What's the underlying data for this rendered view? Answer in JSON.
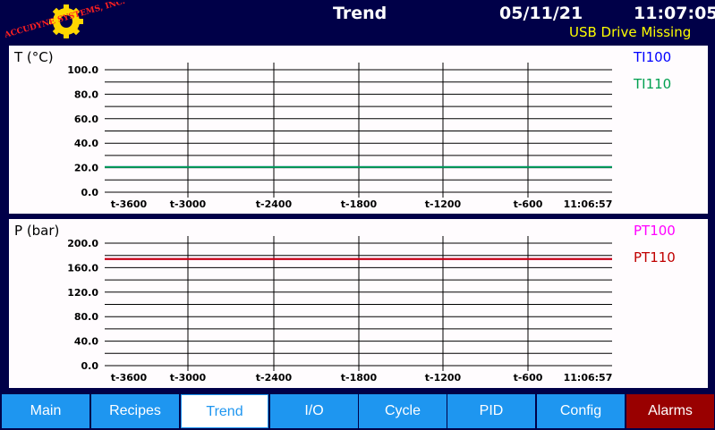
{
  "header": {
    "logo_text": "ACCUDYNE SYSTEMS, INC.",
    "title": "Trend",
    "date": "05/11/21",
    "time": "11:07:05",
    "status": "USB Drive Missing"
  },
  "colors": {
    "background": "#000048",
    "panel": "#fffcfe",
    "nav_button": "#1e96f0",
    "nav_active_bg": "#ffffff",
    "alarm_button": "#990000",
    "status_text": "#ffff00",
    "ti100": "#0000ff",
    "ti110": "#00a050",
    "pt100": "#ff00ff",
    "pt110": "#c00000"
  },
  "temp_chart": {
    "ylabel": "T (°C)",
    "ylim": [
      0,
      100
    ],
    "y_ticks": [
      "100.0",
      "80.0",
      "60.0",
      "40.0",
      "20.0",
      "0.0"
    ],
    "x_ticks": [
      "t-3600",
      "t-3000",
      "t-2400",
      "t-1800",
      "t-1200",
      "t-600",
      "11:06:57"
    ],
    "series": [
      {
        "name": "TI100",
        "color": "#0000ff",
        "values": [
          20.5,
          20.5
        ]
      },
      {
        "name": "TI110",
        "color": "#00a050",
        "values": [
          20.5,
          20.5
        ]
      }
    ]
  },
  "pres_chart": {
    "ylabel": "P (bar)",
    "ylim": [
      0,
      200
    ],
    "y_ticks": [
      "200.0",
      "160.0",
      "120.0",
      "80.0",
      "40.0",
      "0.0"
    ],
    "x_ticks": [
      "t-3600",
      "t-3000",
      "t-2400",
      "t-1800",
      "t-1200",
      "t-600",
      "11:06:57"
    ],
    "series": [
      {
        "name": "PT100",
        "color": "#ff00ff",
        "values": [
          174,
          174
        ]
      },
      {
        "name": "PT110",
        "color": "#c00000",
        "values": [
          174,
          174
        ]
      }
    ]
  },
  "chart_data": [
    {
      "type": "line",
      "ylabel": "T (°C)",
      "ylim": [
        0,
        100
      ],
      "x": [
        "t-3600",
        "11:06:57"
      ],
      "x_tick_labels": [
        "t-3600",
        "t-3000",
        "t-2400",
        "t-1800",
        "t-1200",
        "t-600",
        "11:06:57"
      ],
      "series": [
        {
          "name": "TI100",
          "values": [
            20.5,
            20.5
          ]
        },
        {
          "name": "TI110",
          "values": [
            20.5,
            20.5
          ]
        }
      ],
      "grid": true,
      "legend": "top-right"
    },
    {
      "type": "line",
      "ylabel": "P (bar)",
      "ylim": [
        0,
        200
      ],
      "x": [
        "t-3600",
        "11:06:57"
      ],
      "x_tick_labels": [
        "t-3600",
        "t-3000",
        "t-2400",
        "t-1800",
        "t-1200",
        "t-600",
        "11:06:57"
      ],
      "series": [
        {
          "name": "PT100",
          "values": [
            174,
            174
          ]
        },
        {
          "name": "PT110",
          "values": [
            174,
            174
          ]
        }
      ],
      "grid": true,
      "legend": "top-right"
    }
  ],
  "nav": {
    "items": [
      {
        "label": "Main",
        "name": "nav-main"
      },
      {
        "label": "Recipes",
        "name": "nav-recipes"
      },
      {
        "label": "Trend",
        "name": "nav-trend",
        "active": true
      },
      {
        "label": "I/O",
        "name": "nav-io"
      },
      {
        "label": "Cycle",
        "name": "nav-cycle"
      },
      {
        "label": "PID",
        "name": "nav-pid"
      },
      {
        "label": "Config",
        "name": "nav-config"
      },
      {
        "label": "Alarms",
        "name": "nav-alarms",
        "alarm": true
      }
    ]
  }
}
